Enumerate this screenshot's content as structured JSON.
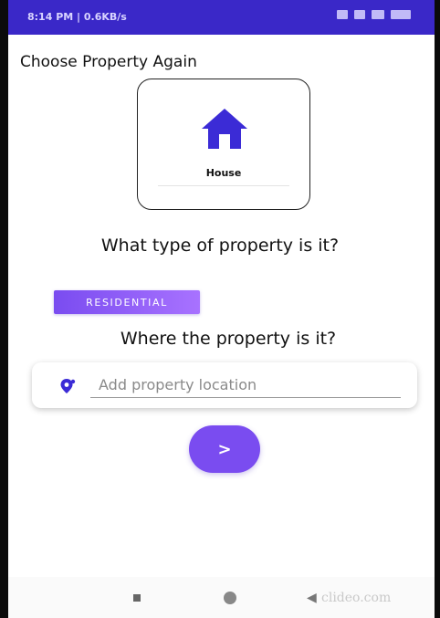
{
  "status_bar": {
    "time_text": "8:14 PM | 0.6KB/s"
  },
  "header": {
    "choose_label": "Choose Property Again"
  },
  "property_card": {
    "label": "House",
    "icon": "house-icon"
  },
  "question_type": "What type of property is it?",
  "chip": {
    "label": "RESIDENTIAL"
  },
  "question_location": "Where the property is it?",
  "location_field": {
    "placeholder": "Add property location",
    "icon": "location-pin-icon"
  },
  "next_button": {
    "label": ">"
  },
  "watermark": "clideo.com",
  "colors": {
    "primary": "#7a4cf0",
    "status_bar": "#3a28c8",
    "icon_blue": "#3b2bd6"
  }
}
